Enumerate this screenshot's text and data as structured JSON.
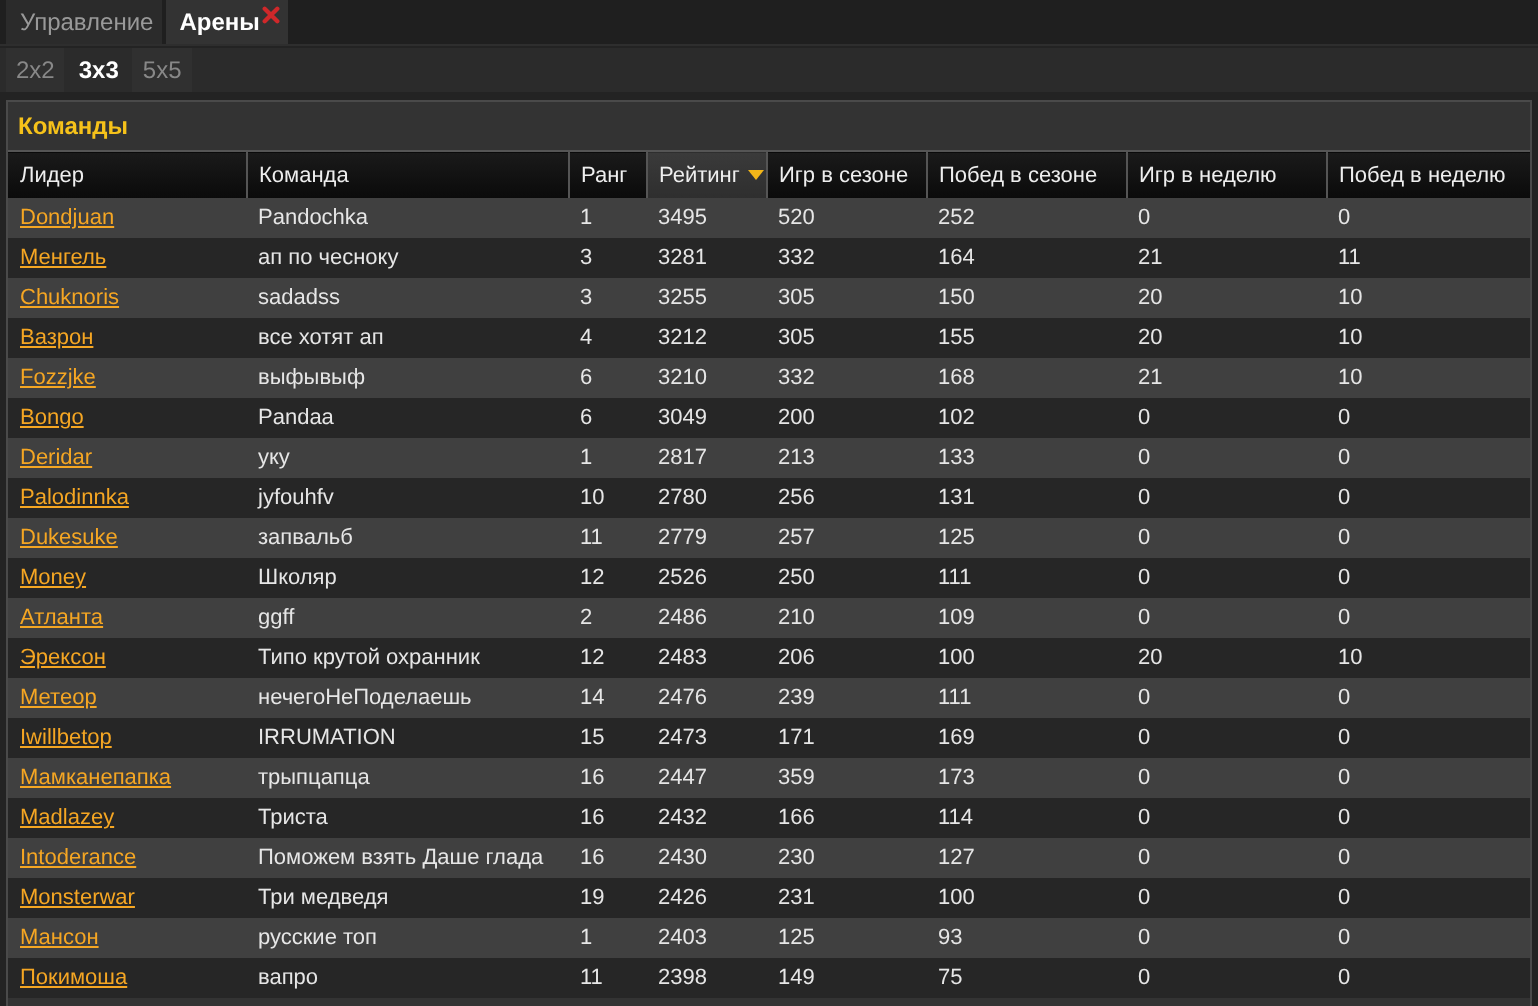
{
  "tabs": [
    {
      "label": "Управление",
      "selected": false,
      "closable": false
    },
    {
      "label": "Арены",
      "selected": true,
      "closable": true
    }
  ],
  "subtabs": [
    {
      "label": "2x2",
      "selected": false
    },
    {
      "label": "3x3",
      "selected": true
    },
    {
      "label": "5x5",
      "selected": false
    }
  ],
  "panel": {
    "title": "Команды"
  },
  "table": {
    "columns": [
      {
        "label": "Лидер",
        "sorted": false
      },
      {
        "label": "Команда",
        "sorted": false
      },
      {
        "label": "Ранг",
        "sorted": false
      },
      {
        "label": "Рейтинг",
        "sorted": true
      },
      {
        "label": "Игр в сезоне",
        "sorted": false
      },
      {
        "label": "Побед в сезоне",
        "sorted": false
      },
      {
        "label": "Игр в неделю",
        "sorted": false
      },
      {
        "label": "Побед в неделю",
        "sorted": false
      }
    ],
    "rows": [
      [
        "Dondjuan",
        "Pandochka",
        "1",
        "3495",
        "520",
        "252",
        "0",
        "0"
      ],
      [
        "Менгель",
        "ап по чесноку",
        "3",
        "3281",
        "332",
        "164",
        "21",
        "11"
      ],
      [
        "Chuknoris",
        "sadadss",
        "3",
        "3255",
        "305",
        "150",
        "20",
        "10"
      ],
      [
        "Вазрон",
        "все хотят ап",
        "4",
        "3212",
        "305",
        "155",
        "20",
        "10"
      ],
      [
        "Fozzjke",
        "выфывыф",
        "6",
        "3210",
        "332",
        "168",
        "21",
        "10"
      ],
      [
        "Bongo",
        "Pandaa",
        "6",
        "3049",
        "200",
        "102",
        "0",
        "0"
      ],
      [
        "Deridar",
        "уку",
        "1",
        "2817",
        "213",
        "133",
        "0",
        "0"
      ],
      [
        "Palodinnka",
        "jyfouhfv",
        "10",
        "2780",
        "256",
        "131",
        "0",
        "0"
      ],
      [
        "Dukesuke",
        "запвальб",
        "11",
        "2779",
        "257",
        "125",
        "0",
        "0"
      ],
      [
        "Money",
        "Школяр",
        "12",
        "2526",
        "250",
        "111",
        "0",
        "0"
      ],
      [
        "Атланта",
        "ggff",
        "2",
        "2486",
        "210",
        "109",
        "0",
        "0"
      ],
      [
        "Эрексон",
        "Типо крутой охранник",
        "12",
        "2483",
        "206",
        "100",
        "20",
        "10"
      ],
      [
        "Метеор",
        "нечегоНеПоделаешь",
        "14",
        "2476",
        "239",
        "111",
        "0",
        "0"
      ],
      [
        "Iwillbetop",
        "IRRUMATION",
        "15",
        "2473",
        "171",
        "169",
        "0",
        "0"
      ],
      [
        "Мамканепапка",
        "трыпцапца",
        "16",
        "2447",
        "359",
        "173",
        "0",
        "0"
      ],
      [
        "Madlazey",
        "Триста",
        "16",
        "2432",
        "166",
        "114",
        "0",
        "0"
      ],
      [
        "Intoderance",
        "Поможем взять Даше глада",
        "16",
        "2430",
        "230",
        "127",
        "0",
        "0"
      ],
      [
        "Monsterwar",
        "Три медведя",
        "19",
        "2426",
        "231",
        "100",
        "0",
        "0"
      ],
      [
        "Мансон",
        "русские топ",
        "1",
        "2403",
        "125",
        "93",
        "0",
        "0"
      ],
      [
        "Покимоша",
        "вапро",
        "11",
        "2398",
        "149",
        "75",
        "0",
        "0"
      ]
    ]
  }
}
